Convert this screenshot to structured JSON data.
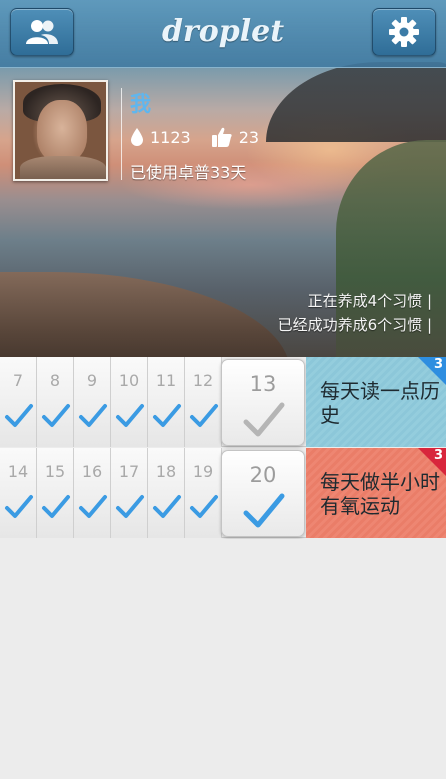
{
  "header": {
    "app_title": "droplet",
    "left_button_icon": "users-icon",
    "right_button_icon": "gear-icon"
  },
  "profile": {
    "name": "我",
    "drops": "1123",
    "likes": "23",
    "used_days_text": "已使用卓普33天",
    "accent_color": "#5fb6ee"
  },
  "summary": {
    "line1": "正在养成4个习惯",
    "line2": "已经成功养成6个习惯"
  },
  "habits": [
    {
      "days": [
        "7",
        "8",
        "9",
        "10",
        "11",
        "12"
      ],
      "today": "13",
      "today_checked": false,
      "title": "每天读一点历史",
      "badge": "3",
      "card_color": "#8cc7d9",
      "badge_color": "#2e8ee0"
    },
    {
      "days": [
        "14",
        "15",
        "16",
        "17",
        "18",
        "19"
      ],
      "today": "20",
      "today_checked": true,
      "title": "每天做半小时有氧运动",
      "badge": "3",
      "card_color": "#ea7d68",
      "badge_color": "#d8263c"
    }
  ]
}
